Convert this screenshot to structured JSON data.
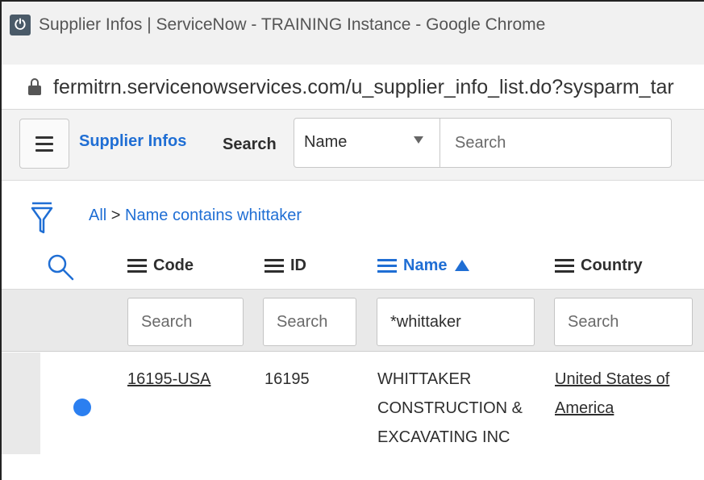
{
  "browser": {
    "window_title": "Supplier Infos | ServiceNow - TRAINING Instance - Google Chrome",
    "app_icon_glyph": "⏻",
    "url": "fermitrn.servicenowservices.com/u_supplier_info_list.do?sysparm_tar"
  },
  "header": {
    "list_title": "Supplier Infos",
    "search_label": "Search",
    "field_select_value": "Name",
    "search_placeholder": "Search"
  },
  "breadcrumb": {
    "all": "All",
    "separator": ">",
    "condition": "Name contains whittaker"
  },
  "columns": [
    {
      "label": "Code",
      "filter_value": "",
      "filter_placeholder": "Search"
    },
    {
      "label": "ID",
      "filter_value": "",
      "filter_placeholder": "Search"
    },
    {
      "label": "Name",
      "filter_value": "*whittaker",
      "filter_placeholder": "Search",
      "sorted": "ascending"
    },
    {
      "label": "Country",
      "filter_value": "",
      "filter_placeholder": "Search"
    }
  ],
  "rows": [
    {
      "code": "16195-USA",
      "id": "16195",
      "name_lines": [
        "WHITTAKER",
        "CONSTRUCTION &",
        "EXCAVATING INC"
      ],
      "country_lines": [
        "United States of",
        "America"
      ]
    }
  ],
  "colors": {
    "accent": "#1f6ed4",
    "status_dot": "#2b7ff0"
  }
}
